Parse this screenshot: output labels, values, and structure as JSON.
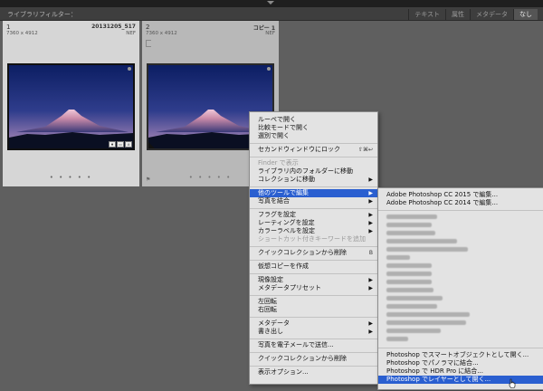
{
  "filterbar": {
    "title": "ライブラリフィルター：",
    "options": [
      "テキスト",
      "属性",
      "メタデータ",
      "なし"
    ],
    "active_option": "なし"
  },
  "cells": [
    {
      "num": "1",
      "name": "20131205_517",
      "dims": "7360 x 4912",
      "ext": "NEF",
      "dots": "• • • • •"
    },
    {
      "num": "2",
      "name": "コピー 1",
      "dims": "7360 x 4912",
      "ext": "NEF",
      "dots": "• • • • •"
    }
  ],
  "context_menu": {
    "items": {
      "loupe": "ルーペで開く",
      "compare": "比較モードで開く",
      "survey": "選別で開く",
      "secondary_lock": "セカンドウィンドウにロック",
      "secondary_lock_shortcut": "⇧⌘↩",
      "finder": "Finder で表示",
      "goto_folder": "ライブラリ内のフォルダーに移動",
      "goto_collection": "コレクションに移動",
      "edit_in": "他のツールで編集",
      "merge": "写真を結合",
      "set_flag": "フラグを設定",
      "set_rating": "レーティングを設定",
      "set_color": "カラーラベルを設定",
      "shortcut_keyword": "ショートカット付きキーワードを追加",
      "remove_quick": "クイックコレクションから削除",
      "remove_quick_shortcut": "B",
      "virtual_copy": "仮想コピーを作成",
      "develop": "現像設定",
      "metadata_preset": "メタデータプリセット",
      "rotate_left": "左回転",
      "rotate_right": "右回転",
      "metadata": "メタデータ",
      "export": "書き出し",
      "email": "写真を電子メールで送信...",
      "remove_quick2": "クイックコレクションから削除",
      "view_options": "表示オプション..."
    }
  },
  "submenu": {
    "items": {
      "ps2015": "Adobe Photoshop CC 2015 で編集...",
      "ps2014": "Adobe Photoshop CC 2014 で編集...",
      "smart_object": "Photoshop でスマートオブジェクトとして開く...",
      "panorama": "Photoshop でパノラマに結合...",
      "hdr": "Photoshop で HDR Pro に結合...",
      "layers": "Photoshop でレイヤーとして開く..."
    }
  },
  "colors": {
    "highlight": "#2a5fd0",
    "menu_bg": "#e3e3e3",
    "grid_bg": "#5f5f5f"
  }
}
